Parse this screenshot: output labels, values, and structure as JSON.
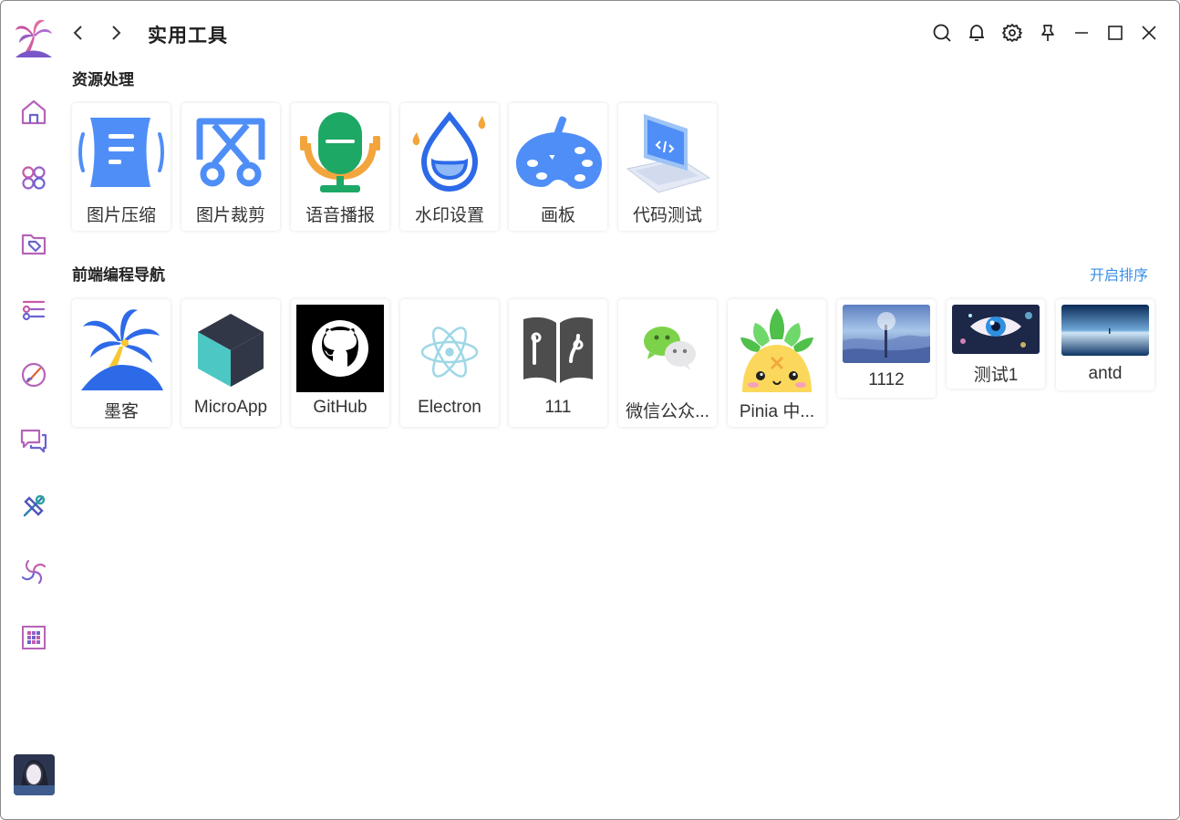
{
  "header": {
    "title": "实用工具"
  },
  "sections": [
    {
      "title": "资源处理",
      "items": [
        {
          "label": "图片压缩",
          "icon": "image-compress-icon"
        },
        {
          "label": "图片裁剪",
          "icon": "image-crop-icon"
        },
        {
          "label": "语音播报",
          "icon": "microphone-icon"
        },
        {
          "label": "水印设置",
          "icon": "watermark-drop-icon"
        },
        {
          "label": "画板",
          "icon": "palette-icon"
        },
        {
          "label": "代码测试",
          "icon": "code-laptop-icon"
        }
      ]
    },
    {
      "title": "前端编程导航",
      "action": "开启排序",
      "items": [
        {
          "label": "墨客",
          "icon": "palm-logo-icon"
        },
        {
          "label": "MicroApp",
          "icon": "cube-icon"
        },
        {
          "label": "GitHub",
          "icon": "github-icon"
        },
        {
          "label": "Electron",
          "icon": "electron-icon"
        },
        {
          "label": "111",
          "icon": "book-icon"
        },
        {
          "label": "微信公众...",
          "icon": "wechat-icon"
        },
        {
          "label": "Pinia 中...",
          "icon": "pinia-icon"
        },
        {
          "label": "1112",
          "icon": "sky-photo"
        },
        {
          "label": "测试1",
          "icon": "eye-photo"
        },
        {
          "label": "antd",
          "icon": "ocean-photo"
        }
      ]
    }
  ],
  "sidebar": {
    "icons": [
      "home-icon",
      "apps-icon",
      "folder-tag-icon",
      "list-settings-icon",
      "brush-icon",
      "chat-icon",
      "tools-icon",
      "spiral-icon",
      "grid-icon"
    ]
  },
  "colors": {
    "accent": "#3b8fe6",
    "icon_blue": "#4f8ef7",
    "sidebar_purple": "#8e5fc4"
  }
}
